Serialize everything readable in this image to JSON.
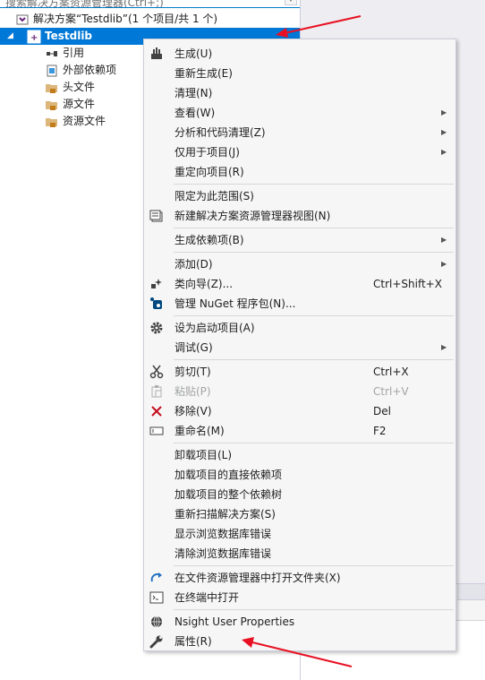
{
  "search": {
    "placeholder": "搜索解决方案资源管理器(Ctrl+;)"
  },
  "tree": {
    "solution_label": "解决方案“Testdlib”(1 个项目/共 1 个)",
    "project_label": "Testdlib",
    "children": [
      {
        "label": "引用",
        "icon": "references-icon"
      },
      {
        "label": "外部依赖项",
        "icon": "external-deps-icon"
      },
      {
        "label": "头文件",
        "icon": "folder-icon"
      },
      {
        "label": "源文件",
        "icon": "folder-icon"
      },
      {
        "label": "资源文件",
        "icon": "folder-icon"
      }
    ]
  },
  "menu": {
    "items": [
      {
        "label": "生成(U)",
        "icon": "build-icon"
      },
      {
        "label": "重新生成(E)"
      },
      {
        "label": "清理(N)"
      },
      {
        "label": "查看(W)",
        "submenu": true
      },
      {
        "label": "分析和代码清理(Z)",
        "submenu": true
      },
      {
        "label": "仅用于项目(J)",
        "submenu": true
      },
      {
        "label": "重定向项目(R)"
      },
      {
        "label": "限定为此范围(S)"
      },
      {
        "label": "新建解决方案资源管理器视图(N)",
        "icon": "new-view-icon"
      },
      {
        "label": "生成依赖项(B)",
        "submenu": true
      },
      {
        "label": "添加(D)",
        "submenu": true
      },
      {
        "label": "类向导(Z)...",
        "shortcut": "Ctrl+Shift+X",
        "icon": "class-wizard-icon"
      },
      {
        "label": "管理 NuGet 程序包(N)...",
        "icon": "nuget-icon"
      },
      {
        "label": "设为启动项目(A)",
        "icon": "gear-icon"
      },
      {
        "label": "调试(G)",
        "submenu": true
      },
      {
        "label": "剪切(T)",
        "shortcut": "Ctrl+X",
        "icon": "scissors-icon"
      },
      {
        "label": "粘贴(P)",
        "shortcut": "Ctrl+V",
        "icon": "paste-icon",
        "disabled": true
      },
      {
        "label": "移除(V)",
        "shortcut": "Del",
        "icon": "remove-icon"
      },
      {
        "label": "重命名(M)",
        "shortcut": "F2",
        "icon": "rename-icon"
      },
      {
        "label": "卸载项目(L)"
      },
      {
        "label": "加载项目的直接依赖项"
      },
      {
        "label": "加载项目的整个依赖树"
      },
      {
        "label": "重新扫描解决方案(S)"
      },
      {
        "label": "显示浏览数据库错误"
      },
      {
        "label": "清除浏览数据库错误"
      },
      {
        "label": "在文件资源管理器中打开文件夹(X)",
        "icon": "open-folder-icon"
      },
      {
        "label": "在终端中打开",
        "icon": "terminal-icon"
      },
      {
        "label": "Nsight User Properties",
        "icon": "nsight-icon"
      },
      {
        "label": "属性(R)",
        "icon": "wrench-icon"
      }
    ]
  },
  "colors": {
    "selection": "#0078d7",
    "menu_bg": "#f6f6f6",
    "annotation_arrow": "#e81123"
  }
}
